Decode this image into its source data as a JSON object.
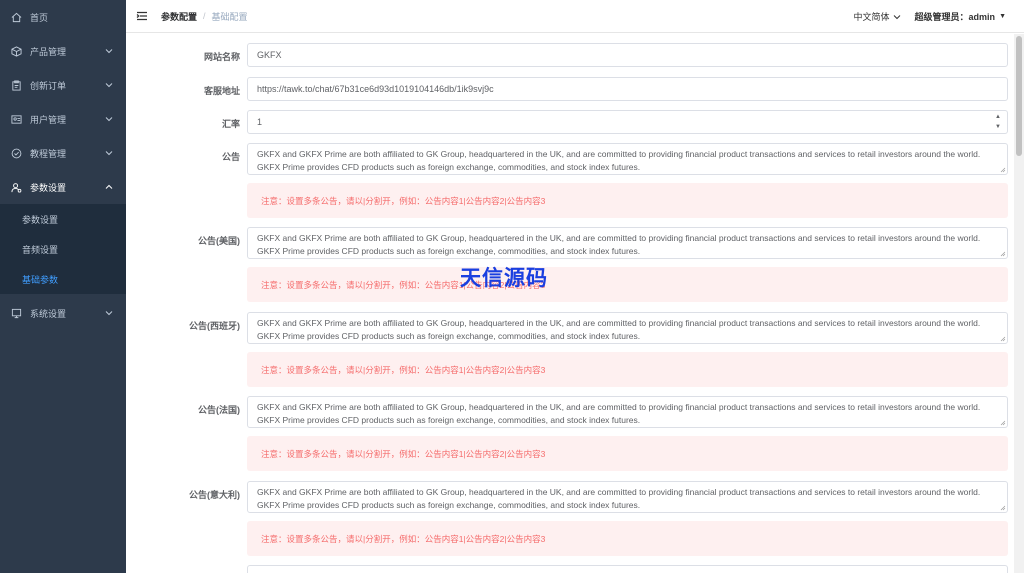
{
  "sidebar": {
    "items": [
      {
        "label": "首页",
        "icon": "home-icon"
      },
      {
        "label": "产品管理",
        "icon": "cube-icon"
      },
      {
        "label": "创新订单",
        "icon": "clipboard-icon"
      },
      {
        "label": "用户管理",
        "icon": "user-card-icon"
      },
      {
        "label": "教程管理",
        "icon": "check-circle-icon"
      },
      {
        "label": "参数设置",
        "icon": "user-settings-icon"
      }
    ],
    "submenu": [
      {
        "label": "参数设置"
      },
      {
        "label": "音频设置"
      },
      {
        "label": "基础参数"
      }
    ],
    "system": {
      "label": "系统设置",
      "icon": "monitor-icon"
    }
  },
  "header": {
    "breadcrumb_1": "参数配置",
    "breadcrumb_sep": "/",
    "breadcrumb_2": "基础配置",
    "language": "中文简体",
    "admin": "超级管理员：admin"
  },
  "form": {
    "site_name_label": "网站名称",
    "site_name_value": "GKFX",
    "service_label": "客服地址",
    "service_value": "https://tawk.to/chat/67b31ce6d93d1019104146db/1ik9svj9c",
    "rate_label": "汇率",
    "rate_value": "1",
    "notice_text": "GKFX and GKFX Prime are both affiliated to GK Group, headquartered in the UK, and are committed to providing financial product transactions and services to retail investors around the world. GKFX Prime provides CFD products such as foreign exchange, commodities, and stock index futures.",
    "notice_hint": "注意：设置多条公告，请以|分割开，例如：公告内容1|公告内容2|公告内容3",
    "notices": [
      {
        "label": "公告"
      },
      {
        "label": "公告(美国)"
      },
      {
        "label": "公告(西班牙)"
      },
      {
        "label": "公告(法国)"
      },
      {
        "label": "公告(意大利)"
      }
    ]
  },
  "watermark": "天信源码",
  "colors": {
    "sidebar_bg": "#2d3a4b",
    "active": "#409eff",
    "alert_bg": "#fef0f0",
    "alert_text": "#f56c6c"
  }
}
